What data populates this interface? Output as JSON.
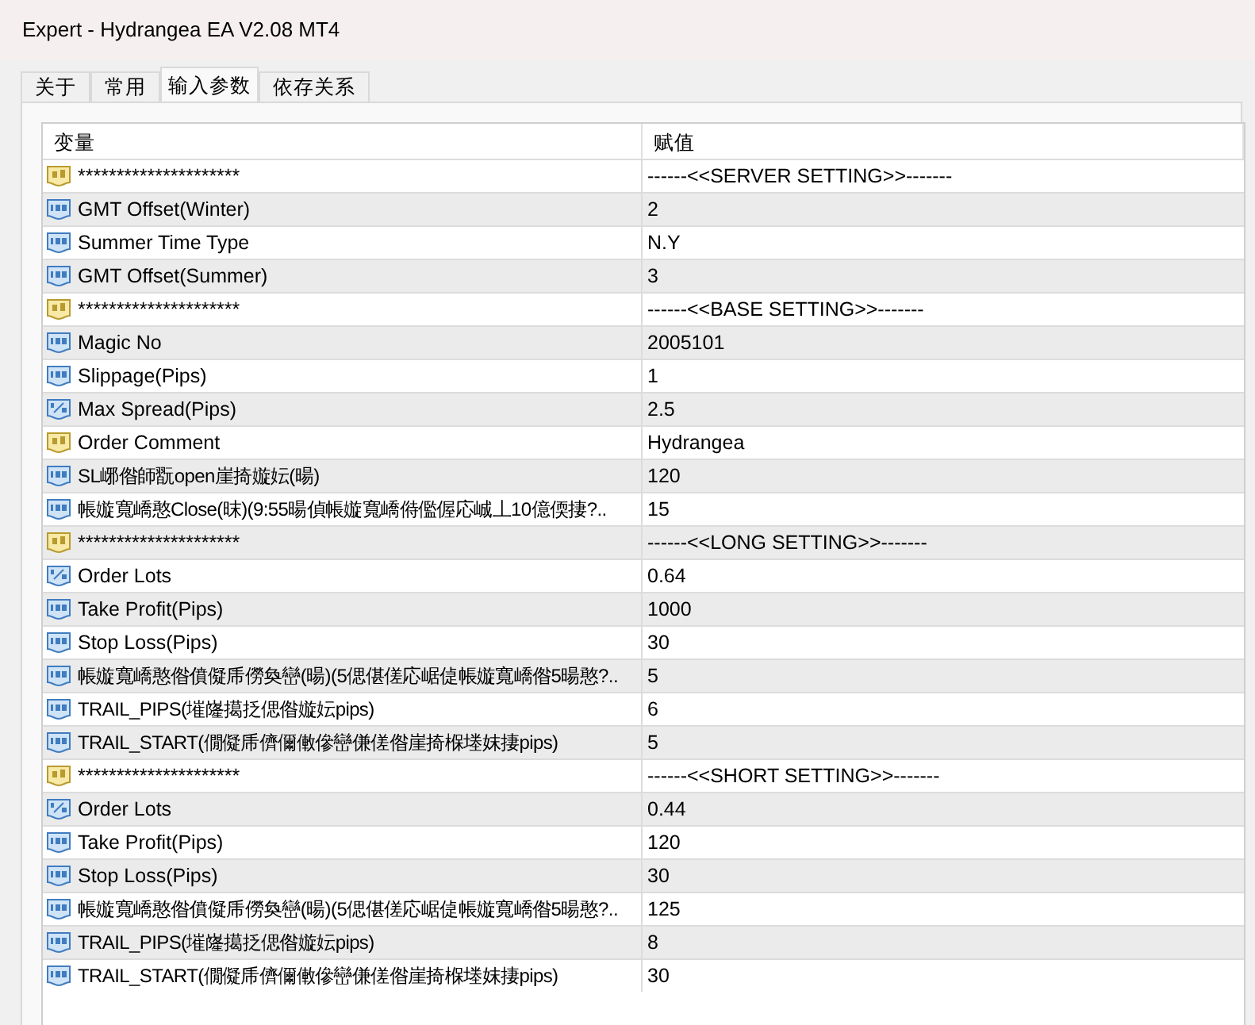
{
  "window": {
    "title": "Expert - Hydrangea EA V2.08 MT4"
  },
  "tabs": [
    {
      "label": "关于",
      "selected": false
    },
    {
      "label": "常用",
      "selected": false
    },
    {
      "label": "输入参数",
      "selected": true
    },
    {
      "label": "依存关系",
      "selected": false
    }
  ],
  "table": {
    "columns": [
      "变量",
      "赋值"
    ],
    "rows": [
      {
        "kind": "string",
        "name": "*********************",
        "value": "------<<SERVER SETTING>>-------"
      },
      {
        "kind": "int",
        "name": "GMT Offset(Winter)",
        "value": "2"
      },
      {
        "kind": "int",
        "name": "Summer Time Type",
        "value": "N.Y"
      },
      {
        "kind": "int",
        "name": "GMT Offset(Summer)",
        "value": "3"
      },
      {
        "kind": "string",
        "name": "*********************",
        "value": "------<<BASE SETTING>>-------"
      },
      {
        "kind": "int",
        "name": "Magic No",
        "value": "2005101"
      },
      {
        "kind": "int",
        "name": "Slippage(Pips)",
        "value": "1"
      },
      {
        "kind": "double",
        "name": "Max Spread(Pips)",
        "value": "2.5"
      },
      {
        "kind": "string",
        "name": "Order Comment",
        "value": "Hydrangea"
      },
      {
        "kind": "int",
        "name": "SL峫偺師翫open崖掎嫙妘(暘)",
        "value": "120"
      },
      {
        "kind": "int",
        "name": "帳嫙寬嶠憨Close(昩)(9:55暘偵帳嫙寬嶠偫儖偓応峸丄10億偄捿?..",
        "value": "15"
      },
      {
        "kind": "string",
        "name": "*********************",
        "value": "------<<LONG SETTING>>-------"
      },
      {
        "kind": "double",
        "name": "Order Lots",
        "value": "0.64"
      },
      {
        "kind": "int",
        "name": "Take Profit(Pips)",
        "value": "1000"
      },
      {
        "kind": "int",
        "name": "Stop Loss(Pips)",
        "value": "30"
      },
      {
        "kind": "int",
        "name": "帳嫙寬嶠憨偺僨儗乕僗奐巒(暘)(5偲偡傞応崌偼帳嫙寬嶠偺5暘憨?..",
        "value": "5"
      },
      {
        "kind": "int",
        "name": "TRAIL_PIPS(墔嶐擖抸偲偺嫙妘pips)",
        "value": "6"
      },
      {
        "kind": "int",
        "name": "TRAIL_START(僩儗乕儕儞僌傪巒傔傞偺崖掎椺堘妺捿pips)",
        "value": "5"
      },
      {
        "kind": "string",
        "name": "*********************",
        "value": "------<<SHORT SETTING>>-------"
      },
      {
        "kind": "double",
        "name": "Order Lots",
        "value": "0.44"
      },
      {
        "kind": "int",
        "name": "Take Profit(Pips)",
        "value": "120"
      },
      {
        "kind": "int",
        "name": "Stop Loss(Pips)",
        "value": "30"
      },
      {
        "kind": "int",
        "name": "帳嫙寬嶠憨偺僨儗乕僗奐巒(暘)(5偲偡傞応崌偼帳嫙寬嶠偺5暘憨?..",
        "value": "125"
      },
      {
        "kind": "int",
        "name": "TRAIL_PIPS(墔嶐擖抸偲偺嫙妘pips)",
        "value": "8"
      },
      {
        "kind": "int",
        "name": "TRAIL_START(僩儗乕儕儞僌傪巒傔傞偺崖掎椺堘妺捿pips)",
        "value": "30"
      }
    ]
  }
}
